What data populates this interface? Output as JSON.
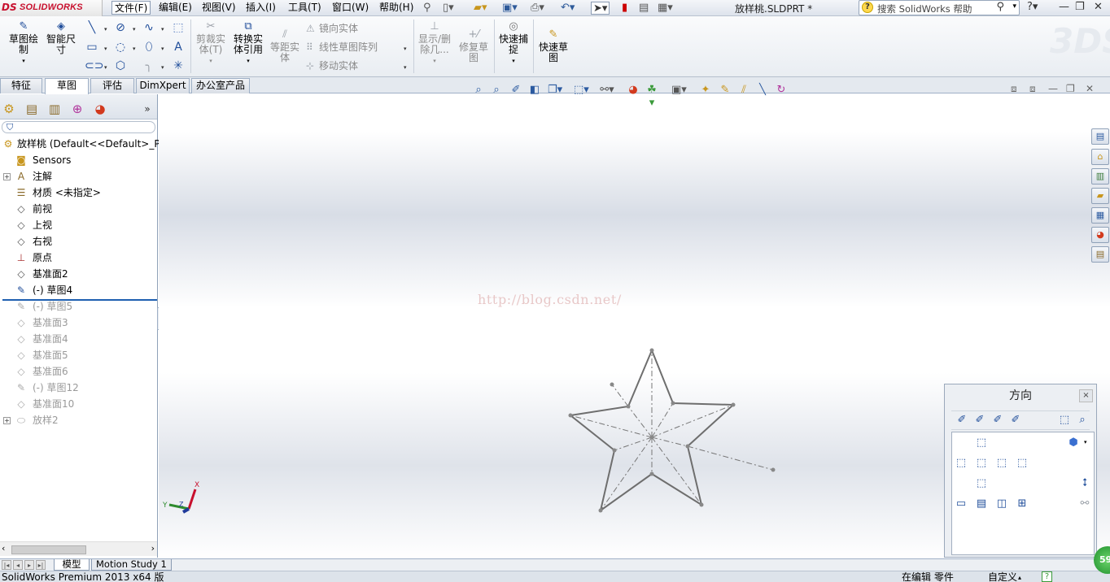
{
  "app": {
    "logo": "SOLIDWORKS",
    "document_title": "放样桃.SLDPRT *",
    "help_search_placeholder": "搜索 SolidWorks 帮助"
  },
  "menu": [
    "文件(F)",
    "编辑(E)",
    "视图(V)",
    "插入(I)",
    "工具(T)",
    "窗口(W)",
    "帮助(H)"
  ],
  "ribbon": {
    "sketch": "草图绘\n制",
    "smart_dimension": "智能尺\n寸",
    "trim_entities": "剪裁实\n体(T)",
    "convert_entities": "转换实\n体引用",
    "offset_entities": "等距实\n体",
    "mirror_entities": "镜向实体",
    "linear_sketch_pattern": "线性草图阵列",
    "move_entities": "移动实体",
    "display_delete_relations": "显示/删\n除几...",
    "repair_sketch": "修复草\n图",
    "quick_snaps": "快速捕\n捉",
    "rapid_sketch": "快速草\n图"
  },
  "tabs": [
    {
      "label": "特征",
      "active": false
    },
    {
      "label": "草图",
      "active": true
    },
    {
      "label": "评估",
      "active": false
    },
    {
      "label": "DimXpert",
      "active": false
    },
    {
      "label": "办公室产品",
      "active": false
    }
  ],
  "feature_tree": {
    "root": "放样桃  (Default<<Default>_P",
    "items": [
      {
        "label": "Sensors",
        "icon": "sensors-icon",
        "rolled_back": false,
        "expandable": false
      },
      {
        "label": "注解",
        "icon": "annotations-icon",
        "rolled_back": false,
        "expandable": true
      },
      {
        "label": "材质 <未指定>",
        "icon": "material-icon",
        "rolled_back": false,
        "expandable": false
      },
      {
        "label": "前视",
        "icon": "plane-icon",
        "rolled_back": false,
        "expandable": false
      },
      {
        "label": "上视",
        "icon": "plane-icon",
        "rolled_back": false,
        "expandable": false
      },
      {
        "label": "右视",
        "icon": "plane-icon",
        "rolled_back": false,
        "expandable": false
      },
      {
        "label": "原点",
        "icon": "origin-icon",
        "rolled_back": false,
        "expandable": false
      },
      {
        "label": "基准面2",
        "icon": "plane-icon",
        "rolled_back": false,
        "expandable": false
      },
      {
        "label": "(-) 草图4",
        "icon": "sketch-icon",
        "rolled_back": false,
        "expandable": false
      },
      {
        "label": "(-) 草图5",
        "icon": "sketch-icon",
        "rolled_back": true,
        "expandable": false
      },
      {
        "label": "基准面3",
        "icon": "plane-icon",
        "rolled_back": true,
        "expandable": false
      },
      {
        "label": "基准面4",
        "icon": "plane-icon",
        "rolled_back": true,
        "expandable": false
      },
      {
        "label": "基准面5",
        "icon": "plane-icon",
        "rolled_back": true,
        "expandable": false
      },
      {
        "label": "基准面6",
        "icon": "plane-icon",
        "rolled_back": true,
        "expandable": false
      },
      {
        "label": "(-) 草图12",
        "icon": "sketch-icon",
        "rolled_back": true,
        "expandable": false
      },
      {
        "label": "基准面10",
        "icon": "plane-icon",
        "rolled_back": true,
        "expandable": false
      },
      {
        "label": "放样2",
        "icon": "loft-icon",
        "rolled_back": true,
        "expandable": true
      }
    ]
  },
  "graphics": {
    "watermark": "http://blog.csdn.net/",
    "triad": {
      "x_label": "X",
      "y_label": "Y",
      "z_label": "Z"
    }
  },
  "orientation_dialog": {
    "title": "方向",
    "close": "×"
  },
  "bottom_tabs": [
    "模型",
    "Motion Study 1"
  ],
  "status": {
    "left": "SolidWorks Premium 2013 x64 版",
    "editing": "在编辑 零件",
    "custom": "自定义",
    "help": "?",
    "badge": "59"
  },
  "colors": {
    "accent": "#1f4d9a",
    "logo_red": "#c8102e",
    "sketch_line": "#6e6e6e",
    "rollback_bar": "#1f5fb0"
  }
}
